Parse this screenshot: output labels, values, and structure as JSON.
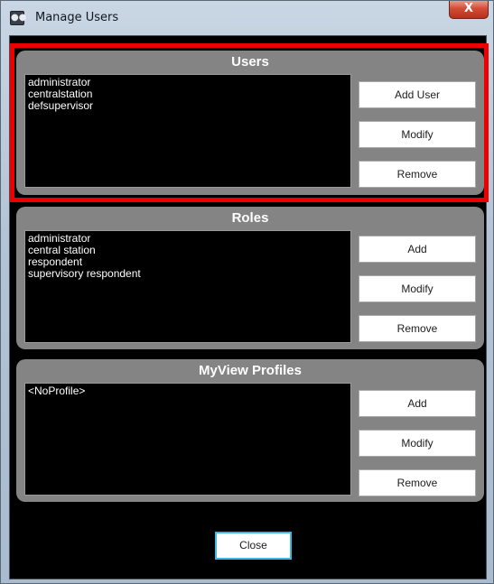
{
  "window": {
    "title": "Manage Users",
    "icon_name": "users-icon",
    "close_glyph": "X"
  },
  "users": {
    "title": "Users",
    "items": [
      "administrator",
      "centralstation",
      "defsupervisor"
    ],
    "buttons": {
      "add": "Add User",
      "modify": "Modify",
      "remove": "Remove"
    },
    "highlight_color": "#ee0000"
  },
  "roles": {
    "title": "Roles",
    "items": [
      "administrator",
      "central station",
      "respondent",
      "supervisory respondent"
    ],
    "buttons": {
      "add": "Add",
      "modify": "Modify",
      "remove": "Remove"
    }
  },
  "profiles": {
    "title": "MyView Profiles",
    "items": [
      "<NoProfile>"
    ],
    "buttons": {
      "add": "Add",
      "modify": "Modify",
      "remove": "Remove"
    }
  },
  "footer": {
    "close_label": "Close"
  },
  "colors": {
    "panel": "#848484",
    "list_background": "#000000",
    "focus_border": "#3fb7e5"
  }
}
